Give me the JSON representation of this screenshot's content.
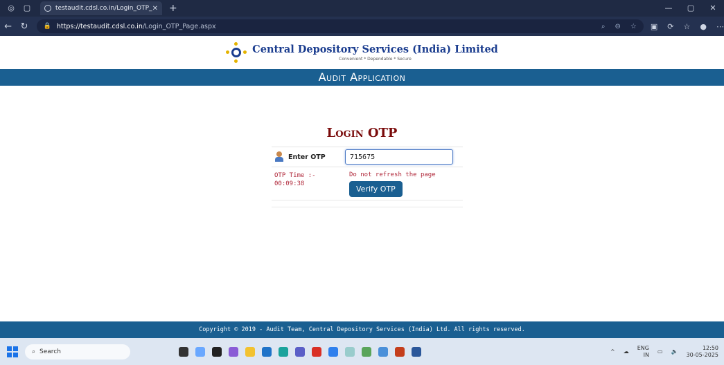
{
  "browser": {
    "tab_title": "testaudit.cdsl.co.in/Login_OTP_Pa",
    "url_host": "https://testaudit.cdsl.co.in",
    "url_path": "/Login_OTP_Page.aspx"
  },
  "header": {
    "brand_name": "Central Depository Services (India) Limited",
    "tagline": "Convenient  *  Dependable  *  Secure",
    "app_title": "Audit Application"
  },
  "login": {
    "title": "Login OTP",
    "otp_label": "Enter OTP",
    "otp_value": "715675",
    "timer_label": "OTP Time :-",
    "timer_value": "00:09:38",
    "warning": "Do not refresh the page",
    "verify_label": "Verify OTP"
  },
  "footer": {
    "copyright": "Copyright © 2019 - Audit Team, Central Depository Services (India) Ltd. All rights reserved."
  },
  "taskbar": {
    "search_label": "Search",
    "lang": "ENG",
    "region": "IN",
    "time": "12:50",
    "date": "30-05-2025"
  },
  "colors": {
    "primary_blue": "#1a5f91",
    "title_maroon": "#7a0b0b",
    "warning_red": "#b0283a"
  }
}
